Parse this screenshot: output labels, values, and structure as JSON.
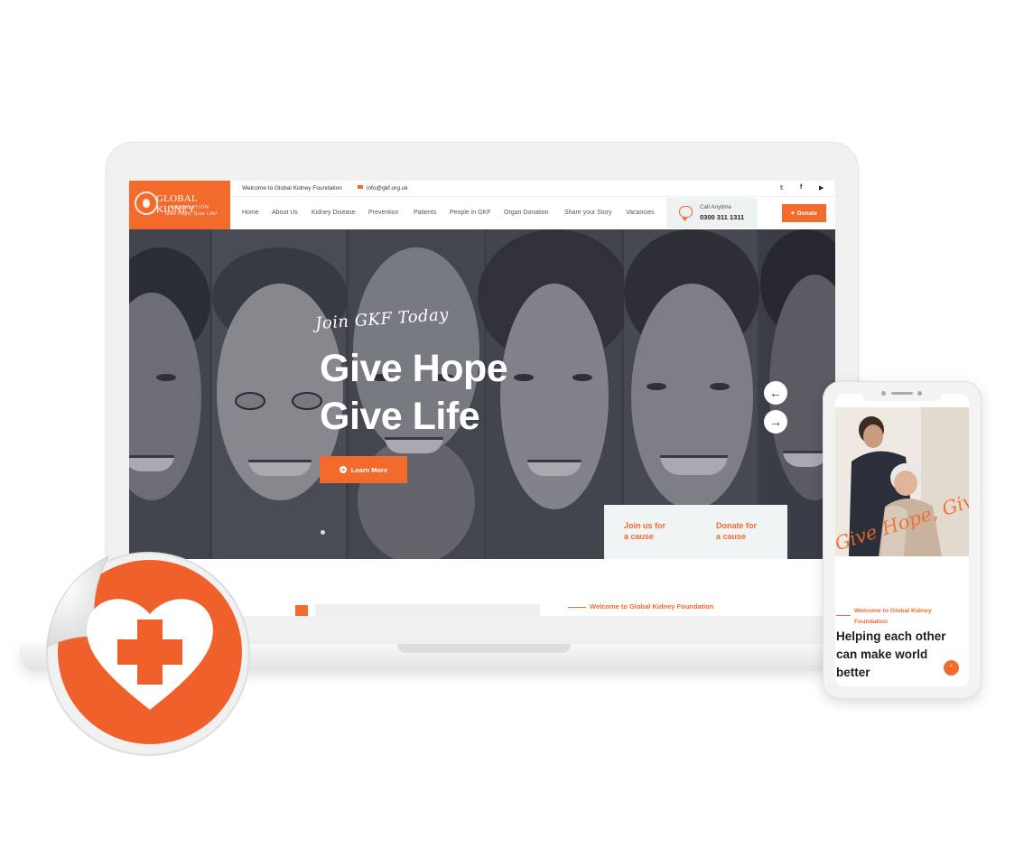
{
  "site": {
    "logo_name": "GLOBAL KIDNEY",
    "logo_sub1": "FOUNDATION",
    "logo_sub2": "Give Hope, Give Life!",
    "welcome_text": "Welcome to Global Kidney Foundation",
    "email": "info@gkf.org.uk",
    "social": [
      "twitter-icon",
      "facebook-icon",
      "youtube-icon"
    ],
    "nav": [
      "Home",
      "About Us",
      "Kidney Disease",
      "Prevention",
      "Patients",
      "People in GKF",
      "Organ Donation",
      "Share your Story",
      "Vacancies"
    ],
    "call_label": "Call Anytime",
    "call_number": "0300 311 1311",
    "donate_label": "Donate",
    "accent": "#f26b2c"
  },
  "hero": {
    "script": "Join GKF Today",
    "headline_1": "Give Hope",
    "headline_2": "Give Life",
    "learn_more": "Learn More",
    "prev": "←",
    "next": "→",
    "cause_1_line1": "Join us for",
    "cause_1_line2": "a cause",
    "cause_2_line1": "Donate for",
    "cause_2_line2": "a cause"
  },
  "about": {
    "welcome": "Welcome to Global Kidney Foundation"
  },
  "mobile": {
    "script": "Give Hope, Give Life",
    "welcome_line1": "Welcome to Global Kidney",
    "welcome_line2": "Foundation",
    "heading_line1": "Helping each other",
    "heading_line2": "can make world",
    "heading_line3": "better",
    "scroll_up": "⌃"
  }
}
